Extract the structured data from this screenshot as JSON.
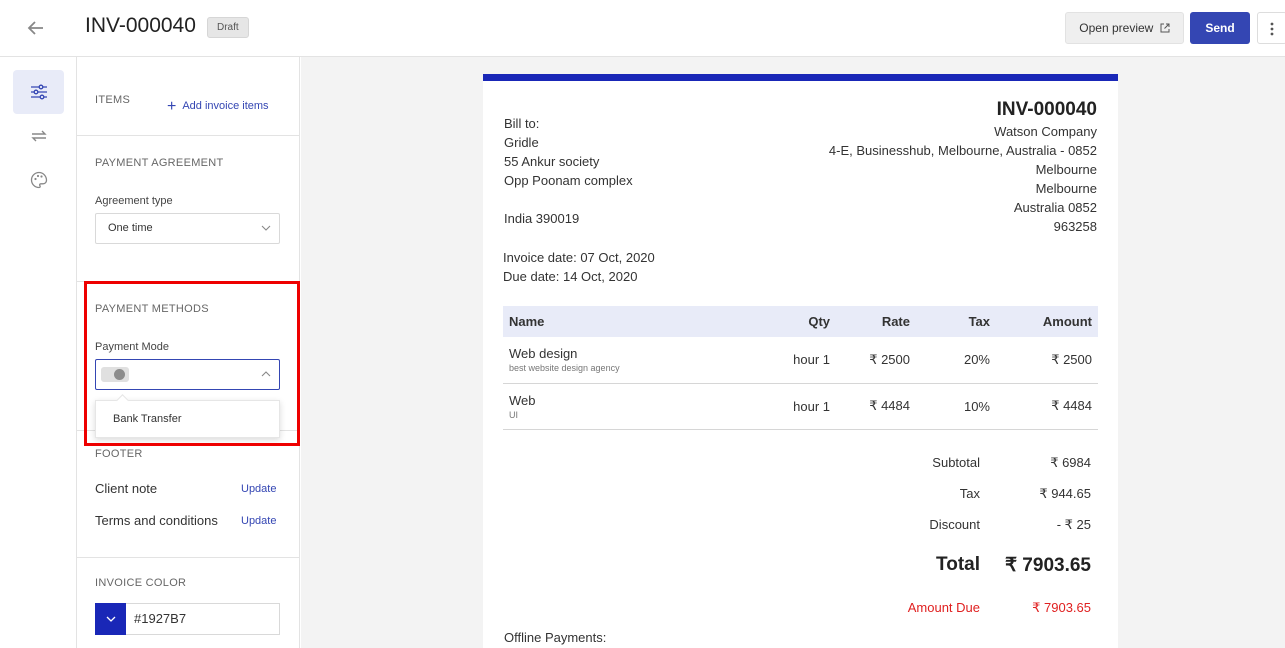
{
  "header": {
    "invoice_number": "INV-000040",
    "status_badge": "Draft",
    "open_preview_label": "Open preview",
    "send_label": "Send"
  },
  "rail": {
    "items": [
      {
        "icon": "sliders-icon",
        "active": true
      },
      {
        "icon": "repeat-icon",
        "active": false
      },
      {
        "icon": "palette-icon",
        "active": false
      }
    ]
  },
  "panel": {
    "items_title": "ITEMS",
    "add_items_label": "Add invoice items",
    "agreement_title": "PAYMENT AGREEMENT",
    "agreement_label": "Agreement type",
    "agreement_value": "One time",
    "methods_title": "PAYMENT METHODS",
    "mode_label": "Payment Mode",
    "mode_option": "Bank Transfer",
    "footer_title": "FOOTER",
    "client_note_label": "Client note",
    "terms_label": "Terms and conditions",
    "update_label": "Update",
    "color_title": "INVOICE COLOR",
    "color_value": "#1927B7"
  },
  "invoice": {
    "number": "INV-000040",
    "accent_color": "#1927B7",
    "bill_to_label": "Bill to:",
    "bill_to": [
      "Gridle",
      "55 Ankur society",
      "Opp Poonam complex",
      "",
      "India 390019"
    ],
    "company": [
      "Watson Company",
      "4-E, Businesshub, Melbourne, Australia - 0852",
      "Melbourne",
      "Melbourne",
      "Australia 0852",
      "963258"
    ],
    "invoice_date": "Invoice date: 07 Oct, 2020",
    "due_date": "Due date: 14 Oct, 2020",
    "columns": [
      "Name",
      "Qty",
      "Rate",
      "Tax",
      "Amount"
    ],
    "rows": [
      {
        "name": "Web design",
        "desc": "best website design agency",
        "qty": "hour 1",
        "rate": "₹ 2500",
        "tax": "20%",
        "amount": "₹ 2500"
      },
      {
        "name": "Web",
        "desc": "UI",
        "qty": "hour 1",
        "rate": "₹ 4484",
        "tax": "10%",
        "amount": "₹ 4484"
      }
    ],
    "subtotal_label": "Subtotal",
    "subtotal": "₹ 6984",
    "tax_label": "Tax",
    "tax": "₹ 944.65",
    "discount_label": "Discount",
    "discount": "- ₹ 25",
    "total_label": "Total",
    "total": "₹ 7903.65",
    "amount_due_label": "Amount Due",
    "amount_due": "₹ 7903.65",
    "offline_label": "Offline Payments:"
  }
}
